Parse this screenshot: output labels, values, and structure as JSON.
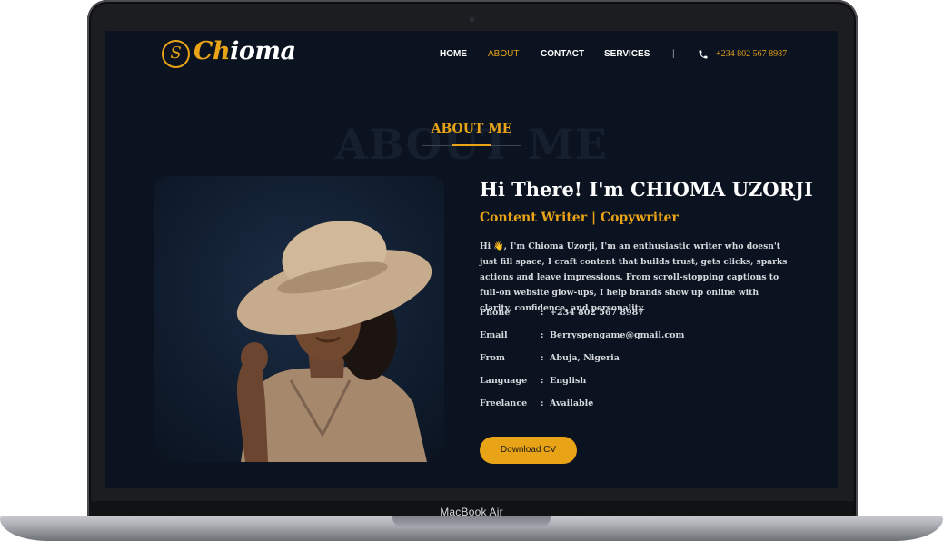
{
  "device": {
    "model_label": "MacBook Air"
  },
  "header": {
    "logo_letter": "S",
    "logo_prefix": "Ch",
    "logo_suffix": "ioma",
    "nav": [
      {
        "label": "HOME",
        "active": false
      },
      {
        "label": "ABOUT",
        "active": true
      },
      {
        "label": "CONTACT",
        "active": false
      },
      {
        "label": "SERVICES",
        "active": false
      }
    ],
    "separator": "|",
    "phone": "+234 802 567 8987"
  },
  "about": {
    "background_title": "ABOUT ME",
    "section_title": "ABOUT ME",
    "heading": "Hi There! I'm CHIOMA UZORJI",
    "subtitle": "Content Writer | Copywriter",
    "bio": "Hi 👋, I'm Chioma Uzorji, I'm an enthusiastic writer who doesn't just fill space, I craft content that builds trust, gets clicks, sparks actions and leave impressions. From scroll-stopping captions to full-on website glow-ups, I help brands show up online with clarity, confidence, and personality.",
    "info": [
      {
        "label": "Phone",
        "value": "+234 802 567 8987"
      },
      {
        "label": "Email",
        "value": "Berryspengame@gmail.com"
      },
      {
        "label": "From",
        "value": "Abuja, Nigeria"
      },
      {
        "label": "Language",
        "value": "English"
      },
      {
        "label": "Freelance",
        "value": "Available"
      }
    ],
    "colon": ":",
    "cv_button": "Download CV"
  },
  "colors": {
    "accent": "#e8a317",
    "background": "#0b1320",
    "text": "#ffffff"
  }
}
